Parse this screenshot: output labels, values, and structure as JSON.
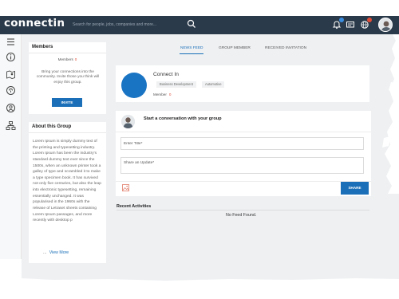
{
  "brand": {
    "logo_text": "connectin"
  },
  "search": {
    "placeholder": "Search for people, jobs, companies and more..."
  },
  "icons": {
    "top": [
      "search-icon",
      "notifications-icon",
      "messages-icon",
      "globe-icon"
    ],
    "rail": [
      "menu-icon",
      "info-icon",
      "map-icon",
      "link-icon",
      "group-icon",
      "network-icon"
    ]
  },
  "colors": {
    "topbar": "#2b3a4a",
    "accent": "#1a6fb8",
    "badge_blue": "#3b8de0",
    "badge_red": "#e04d38"
  },
  "members": {
    "title": "Members",
    "label": "Members",
    "count": "0",
    "invite_text": "Bring your connections into the community. Invite those you think will enjoy this group.",
    "invite_button": "INVITE"
  },
  "about": {
    "title": "About this Group",
    "text": "Lorem Ipsum is simply dummy text of the printing and typesetting industry. Lorem Ipsum has been the industry's standard dummy text ever since the 1500s, when an unknown printer took a galley of type and scrambled it to make a type specimen book. It has survived not only five centuries, but also the leap into electronic typesetting, remaining essentially unchanged. It was popularised in the 1960s with the release of Letraset sheets containing Lorem Ipsum passages, and more recently with desktop p",
    "dots": "...",
    "view_more": "View More"
  },
  "tabs": [
    {
      "label": "NEWS FEED",
      "active": true
    },
    {
      "label": "GROUP MEMBER",
      "active": false
    },
    {
      "label": "RECEIVED INVITATION",
      "active": false
    }
  ],
  "group": {
    "name": "Connect In",
    "tags": [
      "Business Development",
      "Automotive"
    ],
    "members_label": "Member",
    "members_count": "0"
  },
  "post": {
    "title": "Start a conversation with your group",
    "title_placeholder": "Enter Title*",
    "update_placeholder": "Share an Update*",
    "share_button": "SHARE"
  },
  "recent": {
    "title": "Recent Activities",
    "empty_text": "No Feed Found."
  }
}
